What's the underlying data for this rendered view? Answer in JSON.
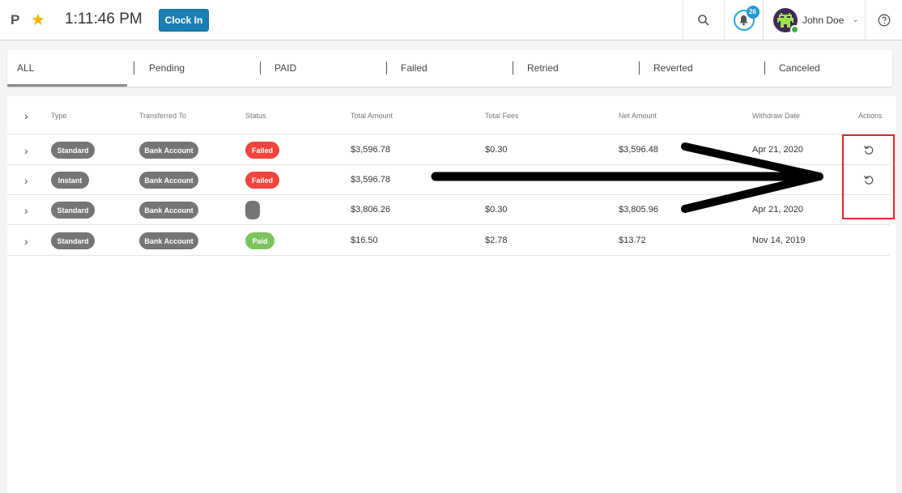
{
  "header": {
    "brand_letter": "P",
    "time": "1:11:46 PM",
    "clock_in_label": "Clock In",
    "notification_count": "26",
    "user_name": "John Doe"
  },
  "tabs": [
    "ALL",
    "Pending",
    "PAID",
    "Failed",
    "Retried",
    "Reverted",
    "Canceled"
  ],
  "table": {
    "columns": [
      "Type",
      "Transferred To",
      "Status",
      "Total Amount",
      "Total Fees",
      "Net Amount",
      "Withdraw Date",
      "Actions"
    ],
    "rows": [
      {
        "type": "Standard",
        "to": "Bank Account",
        "status": "Failed",
        "total": "$3,596.78",
        "fees": "$0.30",
        "net": "$3,596.48",
        "date": "Apr 21, 2020",
        "action": "retry-icon"
      },
      {
        "type": "Instant",
        "to": "Bank Account",
        "status": "Failed",
        "total": "$3,596.78",
        "fees": "",
        "net": "",
        "date": "",
        "action": "retry-icon"
      },
      {
        "type": "Standard",
        "to": "Bank Account",
        "status": "",
        "total": "$3,806.26",
        "fees": "$0.30",
        "net": "$3,805.96",
        "date": "Apr 21, 2020",
        "action": ""
      },
      {
        "type": "Standard",
        "to": "Bank Account",
        "status": "Paid",
        "total": "$16.50",
        "fees": "$2.78",
        "net": "$13.72",
        "date": "Nov 14, 2019",
        "action": ""
      }
    ]
  },
  "colors": {
    "accent": "#1a7fb3",
    "failed": "#f0443d",
    "paid": "#7cc45c",
    "neutral_pill": "#757575",
    "annotation": "#e0272b"
  },
  "icons": [
    "star-icon",
    "search-icon",
    "bell-icon",
    "chevron-down-icon",
    "help-icon",
    "chevron-right-icon",
    "retry-icon"
  ]
}
